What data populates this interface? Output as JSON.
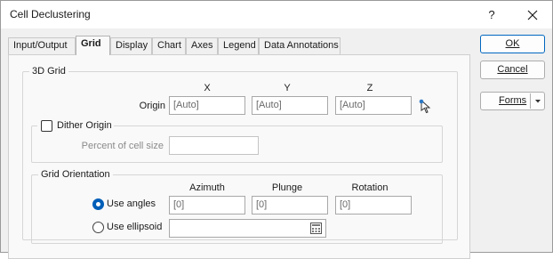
{
  "window": {
    "title": "Cell Declustering",
    "help_glyph": "?",
    "close_glyph": "✕"
  },
  "tabs": [
    {
      "label": "Input/Output",
      "active": false
    },
    {
      "label": "Grid",
      "active": true
    },
    {
      "label": "Display",
      "active": false
    },
    {
      "label": "Chart",
      "active": false
    },
    {
      "label": "Axes",
      "active": false
    },
    {
      "label": "Legend",
      "active": false
    },
    {
      "label": "Data Annotations",
      "active": false
    }
  ],
  "buttons": {
    "ok": "OK",
    "cancel": "Cancel",
    "forms": "Forms"
  },
  "grid3d": {
    "title": "3D Grid",
    "headers": {
      "x": "X",
      "y": "Y",
      "z": "Z"
    },
    "origin_label": "Origin",
    "origin_x": "[Auto]",
    "origin_y": "[Auto]",
    "origin_z": "[Auto]",
    "pick_icon": "cursor-pick-icon"
  },
  "dither": {
    "checkbox_label": "Dither Origin",
    "checked": false,
    "percent_label": "Percent of cell size",
    "percent_value": ""
  },
  "orientation": {
    "title": "Grid Orientation",
    "headers": {
      "azimuth": "Azimuth",
      "plunge": "Plunge",
      "rotation": "Rotation"
    },
    "use_angles_label": "Use angles",
    "use_angles_selected": true,
    "azimuth": "[0]",
    "plunge": "[0]",
    "rotation": "[0]",
    "use_ellipsoid_label": "Use ellipsoid",
    "ellipsoid_value": "",
    "ellipsoid_icon": "calculator-icon"
  },
  "colors": {
    "accent": "#005fb8",
    "primary_border": "#0067c0"
  }
}
